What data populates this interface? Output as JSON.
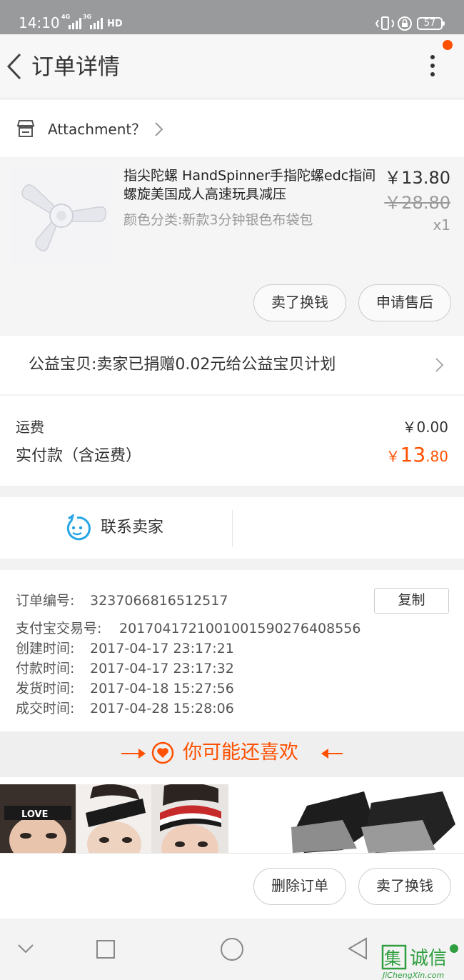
{
  "status_bar": {
    "time": "14:10",
    "network_1": "4G",
    "network_2": "3G",
    "hd": "HD",
    "battery": "57"
  },
  "header": {
    "title": "订单详情"
  },
  "shop": {
    "name": "Attachment？"
  },
  "product": {
    "title": "指尖陀螺 HandSpinner手指陀螺edc指间螺旋美国成人高速玩具减压",
    "sku": "颜色分类:新款3分钟银色布袋包",
    "price": "￥13.80",
    "original_price": "￥28.80",
    "quantity": "x1",
    "actions": [
      "卖了换钱",
      "申请售后"
    ]
  },
  "charity": {
    "text": "公益宝贝:卖家已捐赠0.02元给公益宝贝计划"
  },
  "fees": {
    "shipping_label": "运费",
    "shipping_value": "￥0.00",
    "paid_label": "实付款（含运费）",
    "paid_currency": "￥",
    "paid_int": "13",
    "paid_dec": ".80"
  },
  "contact": {
    "label": "联系卖家"
  },
  "order_info": {
    "copy_label": "复制",
    "rows": [
      {
        "label": "订单编号:",
        "value": "3237066816512517"
      },
      {
        "label": "支付宝交易号:",
        "value": "2017041721001001590276408556"
      },
      {
        "label": "创建时间:",
        "value": "2017-04-17 23:17:21"
      },
      {
        "label": "付款时间:",
        "value": "2017-04-17 23:17:32"
      },
      {
        "label": "发货时间:",
        "value": "2017-04-18 15:27:56"
      },
      {
        "label": "成交时间:",
        "value": "2017-04-28 15:28:06"
      }
    ]
  },
  "recommend": {
    "title": "你可能还喜欢",
    "headband_text": "LOVE"
  },
  "bottom_actions": [
    "删除订单",
    "卖了换钱"
  ],
  "watermark": {
    "chars": "集诚信",
    "url": "JiChengXin.com"
  },
  "colors": {
    "accent": "#ff5000",
    "contact_icon": "#27a6e6",
    "watermark_green": "#2e9e3e"
  }
}
